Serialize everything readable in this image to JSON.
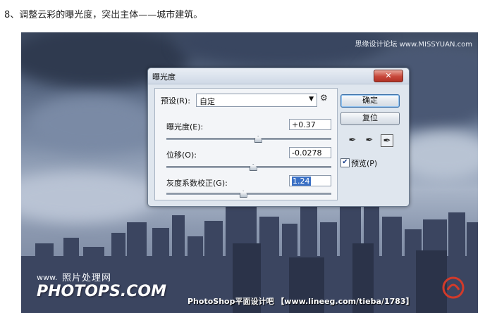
{
  "caption": "8、调整云彩的曝光度，突出主体——城市建筑。",
  "watermarks": {
    "top_right": "思缘设计论坛 www.MISSYUAN.com",
    "left_cn": "照片处理网",
    "left_www": "www.",
    "left_big": "PHOTOPS.COM",
    "bottom": "PhotoShop平面设计吧  【www.lineeg.com/tieba/1783】"
  },
  "dialog": {
    "title": "曝光度",
    "close_symbol": "✕",
    "preset": {
      "label": "预设(R):",
      "value": "自定"
    },
    "exposure": {
      "label": "曝光度(E):",
      "value": "+0.37",
      "slider_pos": 0.55
    },
    "offset": {
      "label": "位移(O):",
      "value": "-0.0278",
      "slider_pos": 0.52
    },
    "gamma": {
      "label": "灰度系数校正(G):",
      "value": "1.24",
      "slider_pos": 0.46
    },
    "ok_label": "确定",
    "reset_label": "复位",
    "preview_label": "预览(P)",
    "preview_checked": true
  },
  "icons": {
    "gear": "gear-icon",
    "eyedroppers": [
      "eyedropper-black-icon",
      "eyedropper-gray-icon",
      "eyedropper-white-icon"
    ]
  },
  "colors": {
    "sky_top": "#3f4c63",
    "sky_light": "#a9b5c8",
    "building": "#3b4560",
    "dialog_bg": "#dfe6ee",
    "close_button": "#c7473a",
    "selection": "#3a70c5"
  }
}
